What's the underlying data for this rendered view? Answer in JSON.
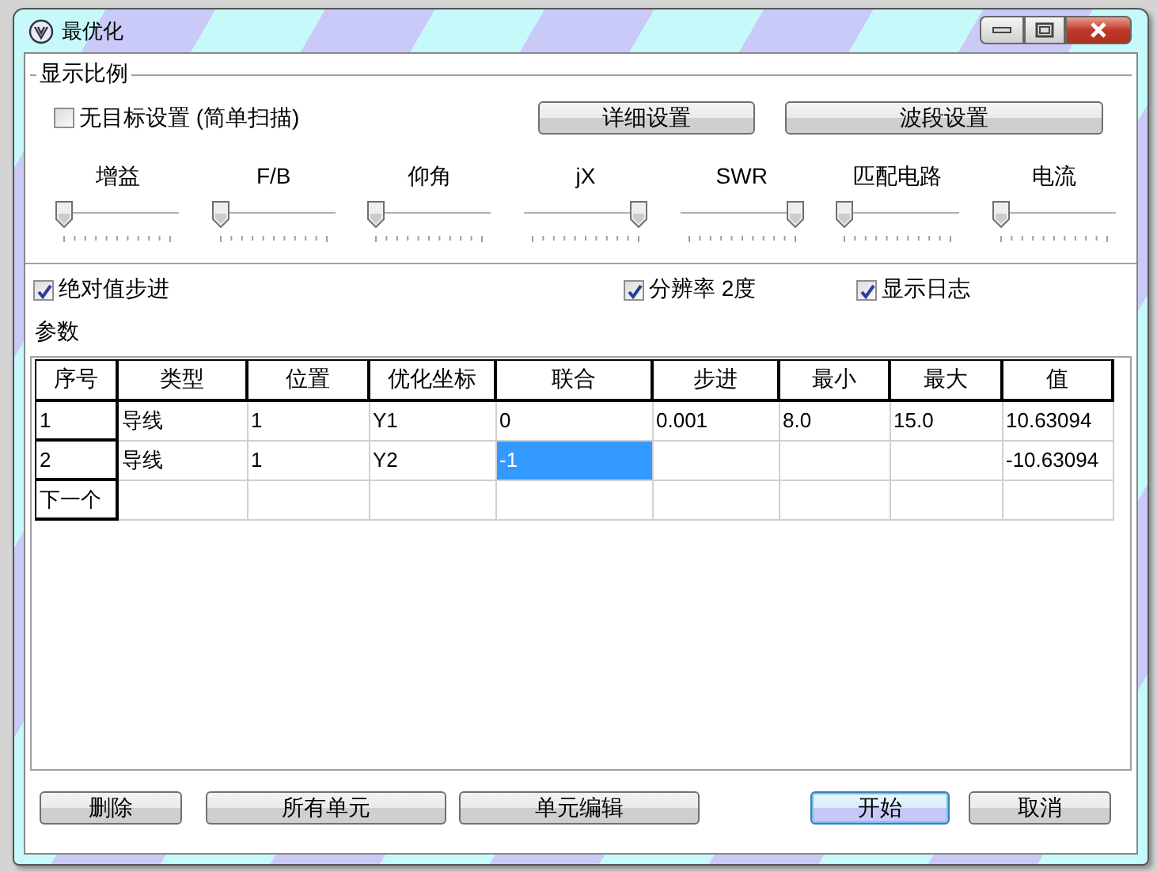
{
  "window": {
    "title": "最优化"
  },
  "display_group": {
    "title": "显示比例",
    "no_target": {
      "label": "无目标设置 (简单扫描)",
      "checked": false
    },
    "buttons": [
      "详细设置",
      "波段设置"
    ],
    "sliders": [
      {
        "label": "增益",
        "level": 0
      },
      {
        "label": "F/B",
        "level": 0
      },
      {
        "label": "仰角",
        "level": 0
      },
      {
        "label": "jX",
        "level": 1
      },
      {
        "label": "SWR",
        "level": 1
      },
      {
        "label": "匹配电路",
        "level": 0
      },
      {
        "label": "电流",
        "level": 0
      }
    ]
  },
  "options": [
    {
      "label": "绝对值步进",
      "checked": true
    },
    {
      "label": "分辨率 2度",
      "checked": true
    },
    {
      "label": "显示日志",
      "checked": true
    }
  ],
  "params_label": "参数",
  "table": {
    "columns": [
      "序号",
      "类型",
      "位置",
      "优化坐标",
      "联合",
      "步进",
      "最小",
      "最大",
      "值"
    ],
    "rows": [
      {
        "cells": [
          {
            "text": "1",
            "selected": false
          },
          {
            "text": "导线",
            "selected": false
          },
          {
            "text": "1",
            "selected": false
          },
          {
            "text": "Y1",
            "selected": false
          },
          {
            "text": "0",
            "selected": false
          },
          {
            "text": "0.001",
            "selected": false
          },
          {
            "text": "8.0",
            "selected": false
          },
          {
            "text": "15.0",
            "selected": false
          },
          {
            "text": "10.63094",
            "selected": false
          }
        ]
      },
      {
        "cells": [
          {
            "text": "2",
            "selected": false
          },
          {
            "text": "导线",
            "selected": false
          },
          {
            "text": "1",
            "selected": false
          },
          {
            "text": "Y2",
            "selected": false
          },
          {
            "text": "-1",
            "selected": true
          },
          {
            "text": "",
            "selected": false
          },
          {
            "text": "",
            "selected": false
          },
          {
            "text": "",
            "selected": false
          },
          {
            "text": "-10.63094",
            "selected": false
          }
        ]
      },
      {
        "cells": [
          {
            "text": "下一个",
            "selected": false
          },
          {
            "text": "",
            "selected": false
          },
          {
            "text": "",
            "selected": false
          },
          {
            "text": "",
            "selected": false
          },
          {
            "text": "",
            "selected": false
          },
          {
            "text": "",
            "selected": false
          },
          {
            "text": "",
            "selected": false
          },
          {
            "text": "",
            "selected": false
          },
          {
            "text": "",
            "selected": false
          }
        ]
      }
    ]
  },
  "footer_buttons": [
    {
      "label": "删除",
      "focused": false
    },
    {
      "label": "所有单元",
      "focused": false
    },
    {
      "label": "单元编辑",
      "focused": false
    },
    {
      "label": "开始",
      "focused": true
    },
    {
      "label": "取消",
      "focused": false
    }
  ]
}
